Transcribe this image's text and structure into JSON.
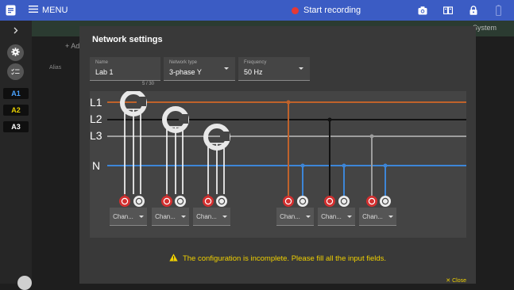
{
  "topbar": {
    "menu_label": "MENU",
    "recording_label": "Start recording",
    "colors": {
      "bar": "#3b5cc4",
      "record": "#e53935"
    }
  },
  "sidebar": {
    "channels": [
      "A1",
      "A2",
      "A3"
    ]
  },
  "background": {
    "alias_label": "Alias",
    "add_label": "+ Ad",
    "system_tab": "System"
  },
  "dialog": {
    "title": "Network settings",
    "name_field": {
      "label": "Name",
      "value": "Lab 1",
      "counter": "5 / 30"
    },
    "network_type": {
      "label": "Network type",
      "value": "3-phase Y"
    },
    "frequency": {
      "label": "Frequency",
      "value": "50 Hz"
    },
    "line_labels": [
      "L1",
      "L2",
      "L3",
      "N"
    ],
    "channel_selects": [
      "Chan...",
      "Chan...",
      "Chan...",
      "Chan...",
      "Chan...",
      "Chan..."
    ],
    "warning": "The configuration is incomplete. Please fill all the input fields.",
    "close_label": "Close",
    "colors": {
      "L1": "#c0622b",
      "L2": "#111111",
      "L3": "#9e9e9e",
      "N": "#3d86d8",
      "warning": "#f0d000"
    }
  }
}
